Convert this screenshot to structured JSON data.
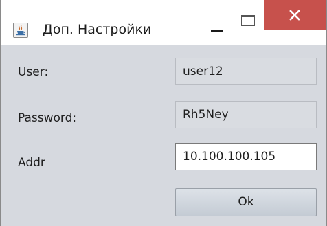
{
  "window": {
    "title": "Доп. Настройки",
    "icons": {
      "app": "java-cup-icon",
      "minimize": "minimize-icon",
      "maximize": "maximize-icon",
      "close": "close-icon"
    },
    "close_color": "#c7514c"
  },
  "form": {
    "user_label": "User:",
    "user_value": "user12",
    "password_label": "Password:",
    "password_value": "Rh5Ney",
    "addr_label": "Addr",
    "addr_value": "10.100.100.105",
    "ok_label": "Ok"
  }
}
